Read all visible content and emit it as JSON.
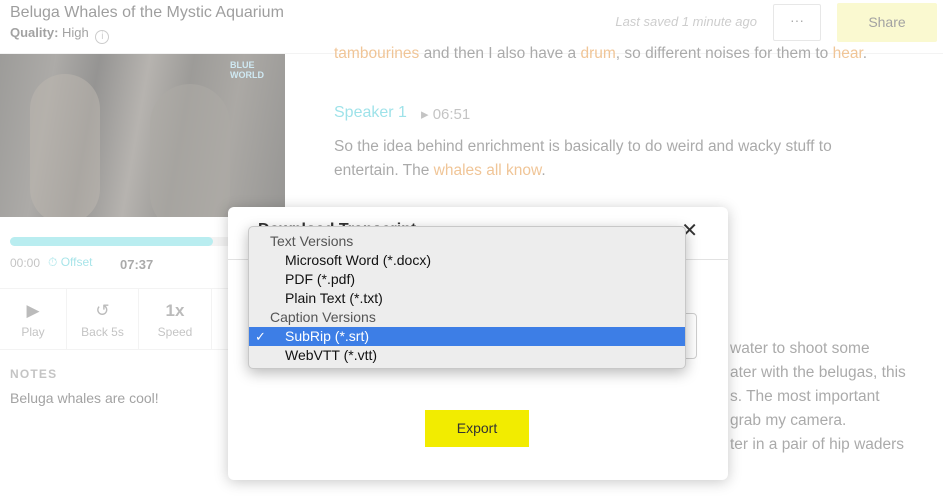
{
  "header": {
    "title": "Beluga Whales of the Mystic Aquarium",
    "quality_label": "Quality:",
    "quality_value": "High",
    "info_glyph": "i",
    "last_saved": "Last saved 1 minute ago",
    "more_glyph": "···",
    "share_label": "Share"
  },
  "player": {
    "progress": 0.75,
    "time_start": "00:00",
    "offset_label": "Offset",
    "time_end": "07:37",
    "controls": [
      {
        "icon": "play-icon",
        "glyph": "▶",
        "label": "Play"
      },
      {
        "icon": "back-5s-icon",
        "glyph": "↺",
        "label": "Back 5s"
      },
      {
        "icon": "speed-icon",
        "glyph": "1x",
        "label": "Speed"
      }
    ]
  },
  "notes": {
    "title": "NOTES",
    "text": "Beluga whales are cool!"
  },
  "transcript": {
    "line1_a": "tambourines",
    "line1_b": " and then I also have a ",
    "line1_c": "drum",
    "line1_d": ", so different noises for them to ",
    "line1_e": "hear",
    "line1_f": ".",
    "speaker": "Speaker 1",
    "speaker_time": "▸ 06:51",
    "para1_a": "So the idea behind enrichment is basically to do weird and wacky stuff to entertain. The ",
    "para1_b": "whales all know",
    "para1_c": ".",
    "para2_lines": [
      "water to shoot some",
      "ater with the belugas, this",
      "s. The most important",
      "grab my camera.",
      "ter in a pair of hip waders"
    ]
  },
  "modal": {
    "title": "Download Transcript",
    "close_glyph": "✕",
    "export_label": "Export"
  },
  "dropdown": {
    "groups": [
      {
        "label": "Text Versions",
        "options": [
          {
            "label": "Microsoft Word (*.docx)",
            "selected": false
          },
          {
            "label": "PDF (*.pdf)",
            "selected": false
          },
          {
            "label": "Plain Text (*.txt)",
            "selected": false
          }
        ]
      },
      {
        "label": "Caption Versions",
        "options": [
          {
            "label": "SubRip (*.srt)",
            "selected": true
          },
          {
            "label": "WebVTT (*.vtt)",
            "selected": false
          }
        ]
      }
    ],
    "check_glyph": "✓"
  },
  "colors": {
    "accent_teal": "#3cc5d2",
    "highlight_orange": "#e08a2e",
    "export_yellow": "#f2ec00",
    "share_yellow": "#f5f2a0",
    "selection_blue": "#3d7ee6"
  }
}
